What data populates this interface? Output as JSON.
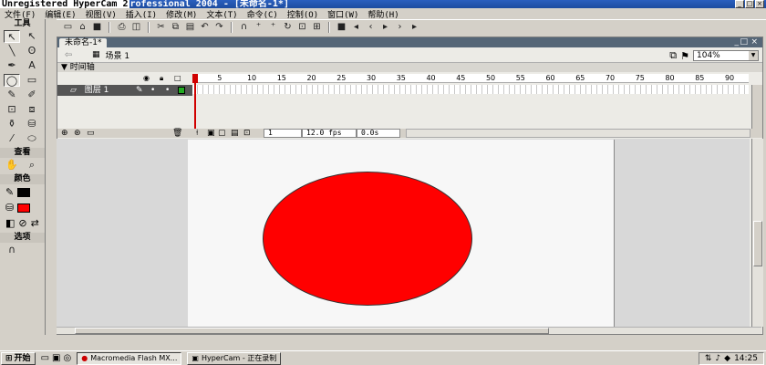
{
  "window": {
    "title_prefix": "Unregistered HyperCam 2",
    "title": "rofessional 2004 - [未命名-1*]",
    "controls": [
      "_",
      "□",
      "×"
    ]
  },
  "menu": [
    "文件(F)",
    "编辑(E)",
    "视图(V)",
    "插入(I)",
    "修改(M)",
    "文本(T)",
    "命令(C)",
    "控制(O)",
    "窗口(W)",
    "帮助(H)"
  ],
  "toolbar": {
    "buttons": [
      "new-icon",
      "open-icon",
      "save-icon",
      "print-icon",
      "print-preview-icon",
      "cut-icon",
      "copy-icon",
      "paste-icon",
      "undo-icon",
      "redo-icon",
      "snap-icon",
      "smooth-icon",
      "straighten-icon",
      "rotate-icon",
      "scale-icon",
      "align-icon"
    ],
    "playback": [
      "stop-icon",
      "rewind-icon",
      "step-back-icon",
      "play-icon",
      "step-forward-icon",
      "end-icon"
    ]
  },
  "tools": {
    "title": "工具",
    "view_label": "查看",
    "colors_label": "颜色",
    "options_label": "选项",
    "stroke_color": "#000000",
    "fill_color": "#ff0000"
  },
  "document": {
    "tab": "未命名-1*",
    "scene": "场景 1",
    "zoom": "104%",
    "controls": [
      "_",
      "□",
      "×"
    ]
  },
  "timeline": {
    "title": "时间轴",
    "layer": "图层 1",
    "ruler": [
      1,
      5,
      10,
      15,
      20,
      25,
      30,
      35,
      40,
      45,
      50,
      55,
      60,
      65,
      70,
      75,
      80,
      85,
      90
    ],
    "frame": "1",
    "fps": "12.0 fps",
    "time": "0.0s"
  },
  "stage": {
    "background": "#f7f7f7",
    "shape_color": "#ff0000"
  },
  "taskbar": {
    "start": "开始",
    "tasks": [
      {
        "label": "Macromedia Flash MX...",
        "active": true
      },
      {
        "label": "HyperCam - 正在录制",
        "active": false
      }
    ],
    "clock": "14:25"
  }
}
